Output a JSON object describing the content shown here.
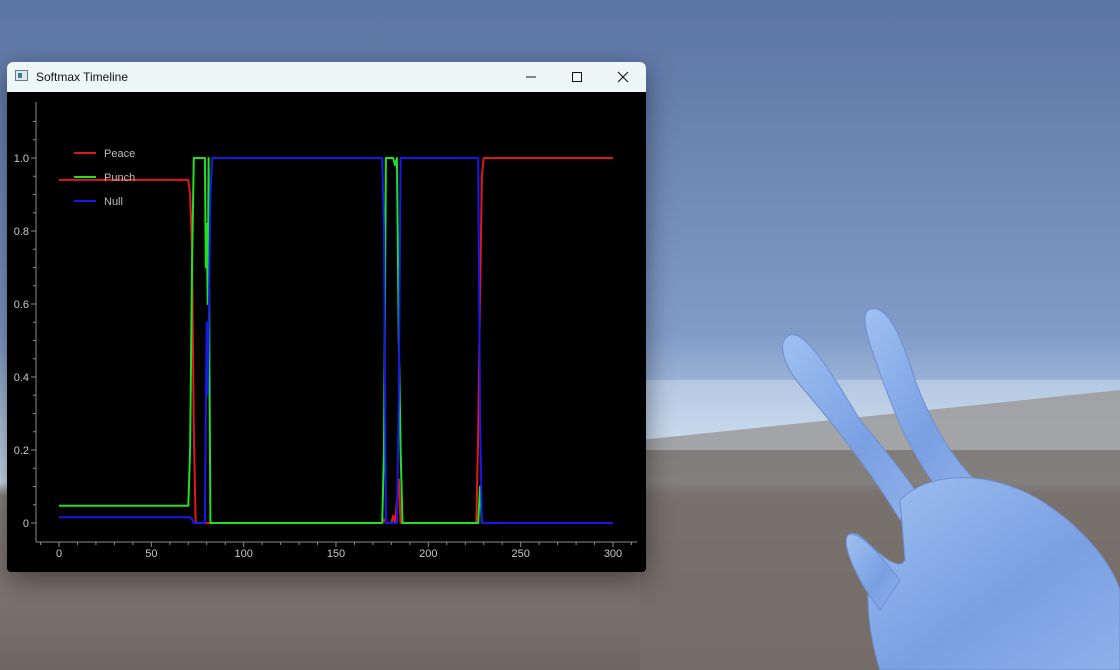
{
  "window": {
    "title": "Softmax Timeline",
    "icons": {
      "app": "app-window-icon",
      "minimize": "minimize-icon",
      "maximize": "maximize-icon",
      "close": "close-icon"
    }
  },
  "chart_data": {
    "type": "line",
    "title": "",
    "xlabel": "",
    "ylabel": "",
    "xlim": [
      0,
      300
    ],
    "ylim": [
      0,
      1.1
    ],
    "xticks": [
      0,
      50,
      100,
      150,
      200,
      250,
      300
    ],
    "xtick_labels": [
      "0",
      "50",
      "100",
      "150",
      "200",
      "250",
      "300"
    ],
    "yticks": [
      0,
      0.2,
      0.4,
      0.6,
      0.8,
      1.0
    ],
    "ytick_labels": [
      "0",
      "0.2",
      "0.4",
      "0.6",
      "0.8",
      "1.0"
    ],
    "grid": false,
    "legend_position": "top-left",
    "series": [
      {
        "name": "Peace",
        "color": "#e01818",
        "points": [
          [
            0,
            0.94
          ],
          [
            70,
            0.94
          ],
          [
            71,
            0.9
          ],
          [
            72,
            0.75
          ],
          [
            73,
            0.25
          ],
          [
            74,
            0
          ],
          [
            175,
            0
          ],
          [
            176,
            0.01
          ],
          [
            177,
            0
          ],
          [
            180,
            0
          ],
          [
            181,
            0.02
          ],
          [
            182,
            0
          ],
          [
            184,
            0.12
          ],
          [
            185,
            0
          ],
          [
            226,
            0
          ],
          [
            227,
            0.25
          ],
          [
            228,
            0.62
          ],
          [
            229,
            0.95
          ],
          [
            230,
            1.0
          ],
          [
            300,
            1.0
          ]
        ]
      },
      {
        "name": "Punch",
        "color": "#20e020",
        "points": [
          [
            0,
            0.047
          ],
          [
            70,
            0.047
          ],
          [
            71,
            0.2
          ],
          [
            72,
            0.7
          ],
          [
            73,
            1.0
          ],
          [
            79,
            1.0
          ],
          [
            79.5,
            0.7
          ],
          [
            80,
            0.82
          ],
          [
            80.5,
            0.6
          ],
          [
            81,
            1.0
          ],
          [
            81.5,
            0.4
          ],
          [
            82,
            0
          ],
          [
            175,
            0
          ],
          [
            176,
            0.2
          ],
          [
            177,
            1.0
          ],
          [
            181,
            1.0
          ],
          [
            182,
            0.98
          ],
          [
            183,
            1.0
          ],
          [
            184,
            0.5
          ],
          [
            185,
            0.2
          ],
          [
            186,
            0
          ],
          [
            227,
            0
          ],
          [
            228,
            0.1
          ],
          [
            229,
            0
          ],
          [
            300,
            0
          ]
        ]
      },
      {
        "name": "Null",
        "color": "#1818e8",
        "points": [
          [
            0,
            0.016
          ],
          [
            71,
            0.016
          ],
          [
            72,
            0.01
          ],
          [
            73,
            0
          ],
          [
            79,
            0
          ],
          [
            79.5,
            0.3
          ],
          [
            80,
            0.55
          ],
          [
            80.5,
            0.35
          ],
          [
            81,
            0.52
          ],
          [
            82,
            0.9
          ],
          [
            83,
            1.0
          ],
          [
            175,
            1.0
          ],
          [
            176,
            0.8
          ],
          [
            177,
            0
          ],
          [
            183,
            0
          ],
          [
            184,
            0.35
          ],
          [
            185,
            1.0
          ],
          [
            227,
            1.0
          ],
          [
            228,
            0.3
          ],
          [
            229,
            0
          ],
          [
            300,
            0
          ]
        ]
      }
    ]
  }
}
